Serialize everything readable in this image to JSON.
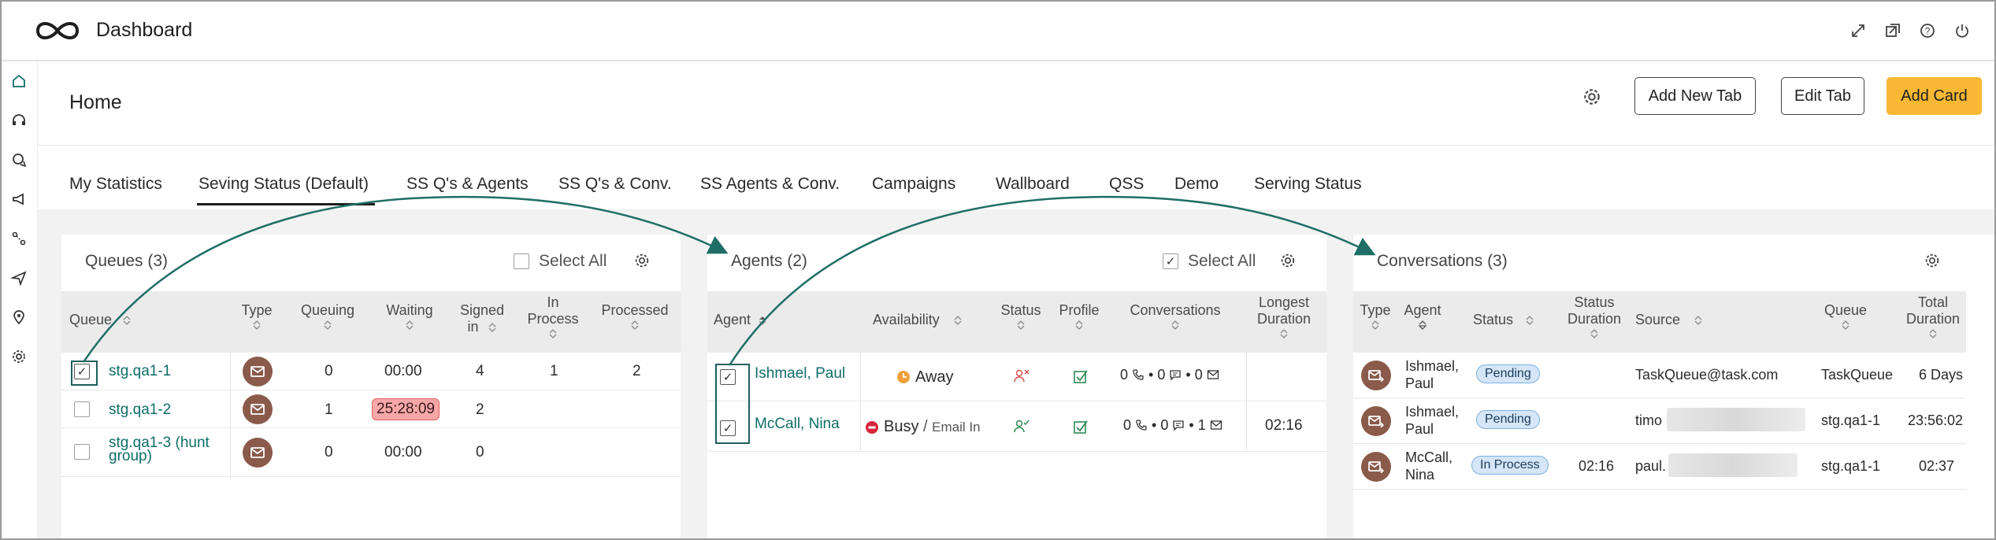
{
  "app": {
    "title": "Dashboard"
  },
  "header": {
    "title": "Home",
    "buttons": {
      "add_new_tab": "Add New Tab",
      "edit_tab": "Edit Tab",
      "add_card": "Add Card"
    }
  },
  "tabs": [
    {
      "label": "My Statistics"
    },
    {
      "label": "Seving Status (Default)",
      "active": true
    },
    {
      "label": "SS Q's & Agents"
    },
    {
      "label": "SS Q's & Conv."
    },
    {
      "label": "SS Agents & Conv."
    },
    {
      "label": "Campaigns"
    },
    {
      "label": "Wallboard"
    },
    {
      "label": "QSS"
    },
    {
      "label": "Demo"
    },
    {
      "label": "Serving Status"
    }
  ],
  "queues": {
    "title": "Queues (3)",
    "select_all": "Select All",
    "columns": {
      "queue": "Queue",
      "type": "Type",
      "queuing": "Queuing",
      "waiting": "Waiting",
      "signed_in_1": "Signed",
      "signed_in_2": "in",
      "in_process_1": "In",
      "in_process_2": "Process",
      "processed": "Processed"
    },
    "rows": [
      {
        "name": "stg.qa1-1",
        "queuing": "0",
        "waiting": "00:00",
        "signed_in": "4",
        "in_process": "1",
        "processed": "2",
        "checked": true
      },
      {
        "name": "stg.qa1-2",
        "queuing": "1",
        "waiting": "25:28:09",
        "signed_in": "2",
        "in_process": "",
        "processed": "",
        "checked": false
      },
      {
        "name_1": "stg.qa1-3 (hunt",
        "name_2": "group)",
        "queuing": "0",
        "waiting": "00:00",
        "signed_in": "0",
        "in_process": "",
        "processed": "",
        "checked": false
      }
    ]
  },
  "agents": {
    "title": "Agents (2)",
    "select_all": "Select All",
    "columns": {
      "agent": "Agent",
      "availability": "Availability",
      "status": "Status",
      "profile": "Profile",
      "conversations": "Conversations",
      "longest_1": "Longest",
      "longest_2": "Duration"
    },
    "rows": [
      {
        "name": "Ishmael, Paul",
        "availability": "Away",
        "availability_detail": "",
        "conv": [
          "0",
          "0",
          "0"
        ],
        "longest": ""
      },
      {
        "name": "McCall, Nina",
        "availability": "Busy",
        "availability_sep": "/",
        "availability_detail": "Email In",
        "conv": [
          "0",
          "0",
          "1"
        ],
        "longest": "02:16"
      }
    ]
  },
  "conversations": {
    "title": "Conversations (3)",
    "columns": {
      "type": "Type",
      "agent": "Agent",
      "status": "Status",
      "status_duration_1": "Status",
      "status_duration_2": "Duration",
      "source": "Source",
      "queue": "Queue",
      "total_1": "Total",
      "total_2": "Duration"
    },
    "rows": [
      {
        "agent_1": "Ishmael,",
        "agent_2": "Paul",
        "status": "Pending",
        "status_duration": "",
        "source": "TaskQueue@task.com",
        "queue": "TaskQueue",
        "total": "6 Days"
      },
      {
        "agent_1": "Ishmael,",
        "agent_2": "Paul",
        "status": "Pending",
        "status_duration": "",
        "source": "timo",
        "queue": "stg.qa1-1",
        "total": "23:56:02"
      },
      {
        "agent_1": "McCall,",
        "agent_2": "Nina",
        "status": "In Process",
        "status_duration": "02:16",
        "source": "paul.",
        "queue": "stg.qa1-1",
        "total": "02:37"
      }
    ]
  },
  "colors": {
    "accent": "#0f6d67",
    "add_card": "#f8b833",
    "badge": "#8a5a4a",
    "alert": "#f7a7a7",
    "pill": "#d4e6f7"
  },
  "icons": [
    "logo-icon",
    "expand-icon",
    "popout-icon",
    "help-icon",
    "power-icon",
    "home-icon",
    "headset-icon",
    "chat-icon",
    "megaphone-icon",
    "flow-icon",
    "send-icon",
    "location-icon",
    "settings-icon",
    "gear-icon",
    "email-icon",
    "phone-icon",
    "chat-bubble-icon",
    "away-clock-icon",
    "busy-icon",
    "agent-status-icon",
    "profile-check-icon"
  ]
}
